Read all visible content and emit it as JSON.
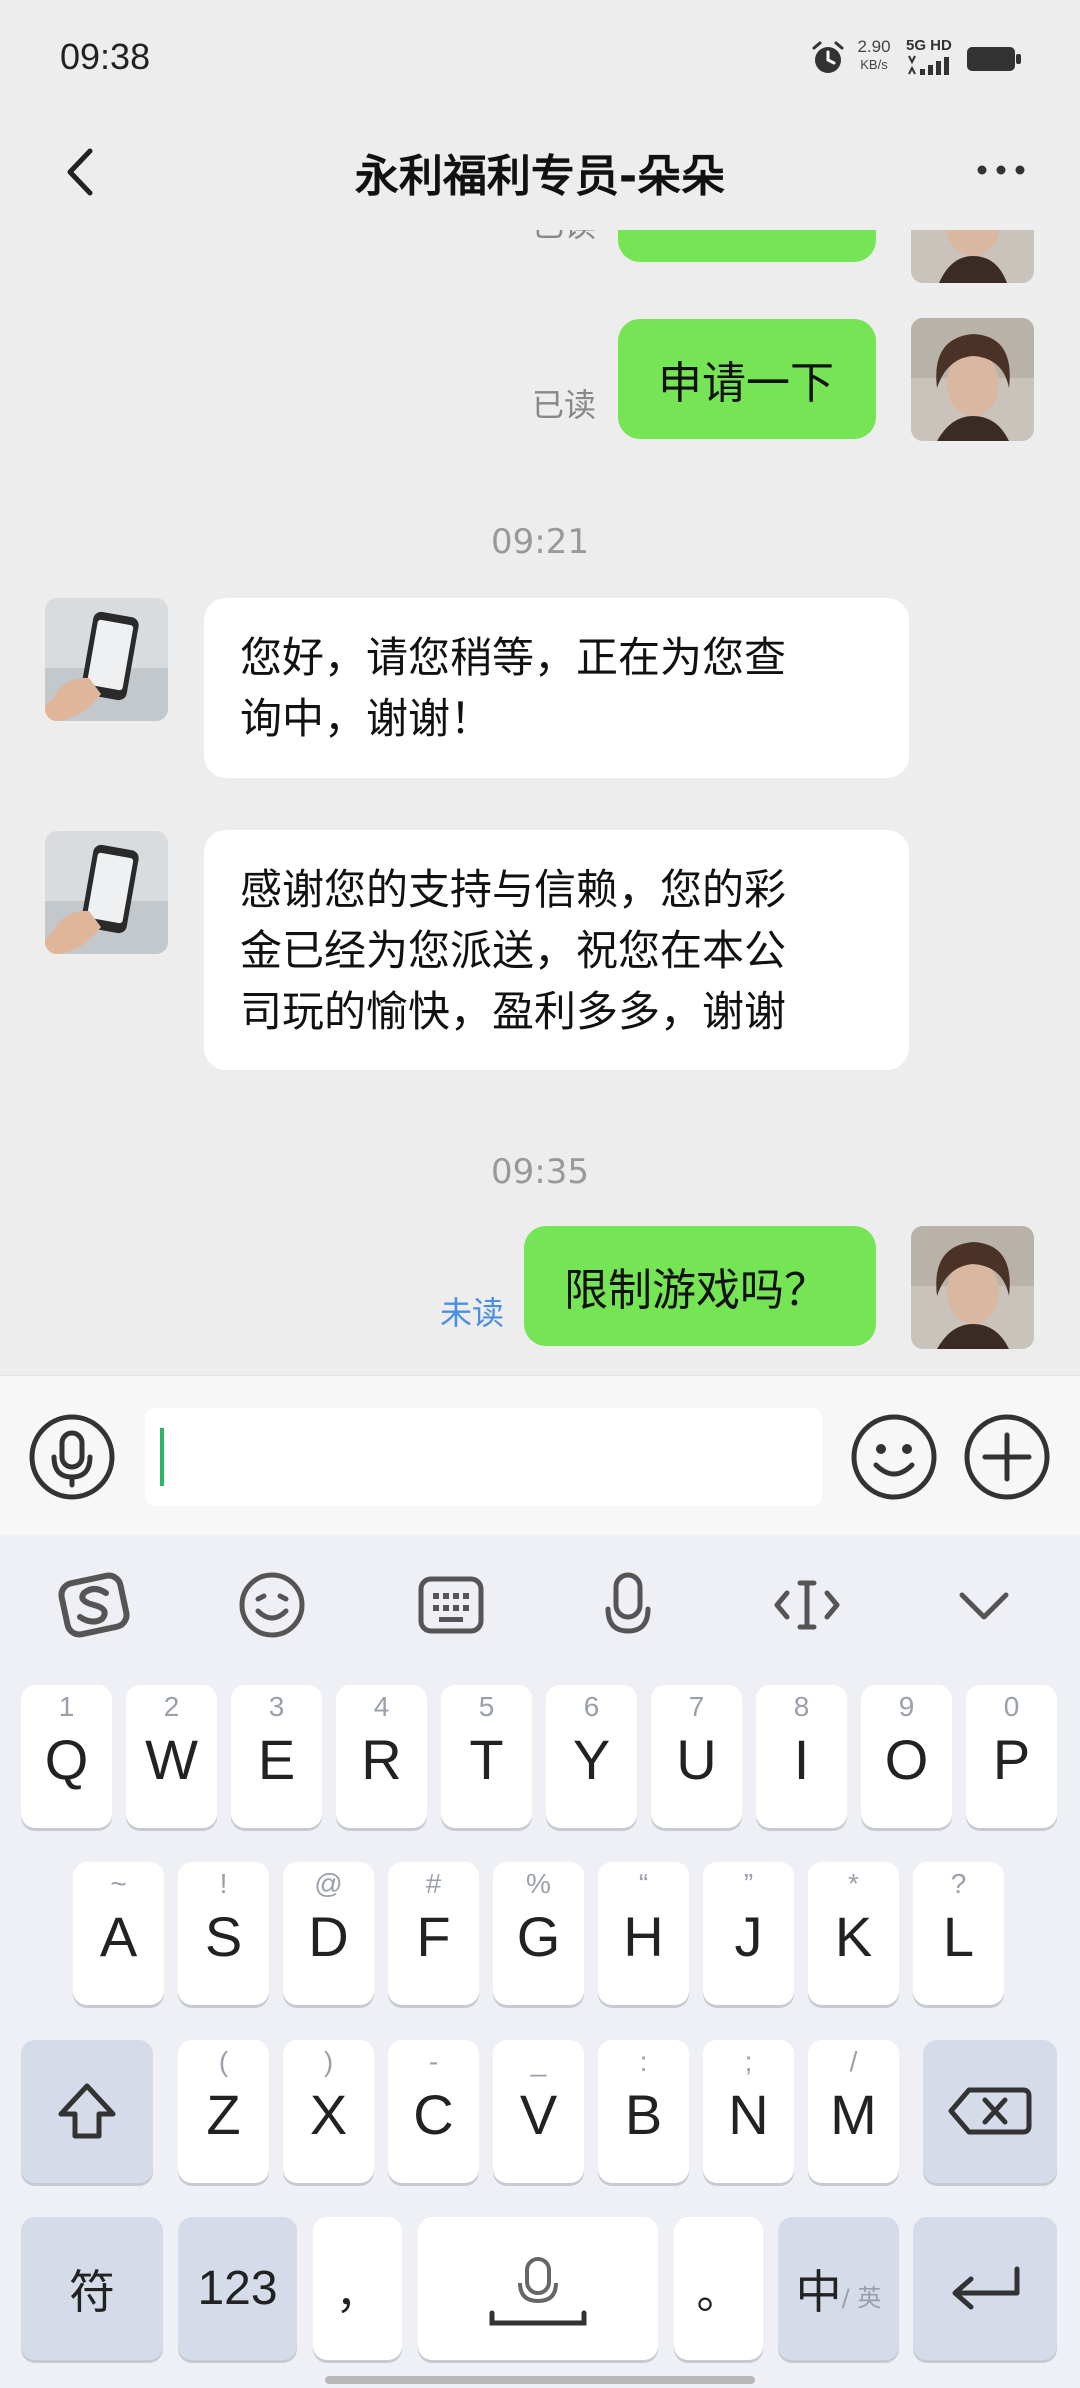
{
  "status_bar": {
    "time": "09:38",
    "net_speed_value": "2.90",
    "net_speed_unit": "KB/s",
    "signal_label": "5G HD"
  },
  "header": {
    "title": "永利福利专员-朵朵"
  },
  "chat": {
    "messages": [
      {
        "from": "me",
        "read_status": "已读"
      },
      {
        "from": "me",
        "text": "申请一下",
        "read_status": "已读"
      },
      {
        "type": "timestamp",
        "text": "09:21"
      },
      {
        "from": "other",
        "lines": [
          "您好，请您稍等，正在为您查",
          "询中，谢谢！"
        ]
      },
      {
        "from": "other",
        "lines": [
          "感谢您的支持与信赖，您的彩",
          "金已经为您派送，祝您在本公",
          "司玩的愉快，盈利多多，谢谢"
        ]
      },
      {
        "type": "timestamp",
        "text": "09:35"
      },
      {
        "from": "me",
        "text": "限制游戏吗？",
        "read_status": "未读"
      }
    ],
    "colors": {
      "my_bubble": "#75e555",
      "other_bubble": "#ffffff",
      "unread": "#4a90e2",
      "read": "#888888"
    }
  },
  "input": {
    "value": ""
  },
  "keyboard": {
    "toolbar": [
      "sogou-logo-icon",
      "emoji-icon",
      "keyboard-icon",
      "microphone-icon",
      "cursor-move-icon",
      "collapse-icon"
    ],
    "row1": [
      {
        "hint": "1",
        "key": "Q"
      },
      {
        "hint": "2",
        "key": "W"
      },
      {
        "hint": "3",
        "key": "E"
      },
      {
        "hint": "4",
        "key": "R"
      },
      {
        "hint": "5",
        "key": "T"
      },
      {
        "hint": "6",
        "key": "Y"
      },
      {
        "hint": "7",
        "key": "U"
      },
      {
        "hint": "8",
        "key": "I"
      },
      {
        "hint": "9",
        "key": "O"
      },
      {
        "hint": "0",
        "key": "P"
      }
    ],
    "row2": [
      {
        "hint": "~",
        "key": "A"
      },
      {
        "hint": "!",
        "key": "S"
      },
      {
        "hint": "@",
        "key": "D"
      },
      {
        "hint": "#",
        "key": "F"
      },
      {
        "hint": "%",
        "key": "G"
      },
      {
        "hint": "“",
        "key": "H"
      },
      {
        "hint": "”",
        "key": "J"
      },
      {
        "hint": "*",
        "key": "K"
      },
      {
        "hint": "?",
        "key": "L"
      }
    ],
    "row3": [
      {
        "hint": "(",
        "key": "Z"
      },
      {
        "hint": ")",
        "key": "X"
      },
      {
        "hint": "-",
        "key": "C"
      },
      {
        "hint": "_",
        "key": "V"
      },
      {
        "hint": ":",
        "key": "B"
      },
      {
        "hint": ";",
        "key": "N"
      },
      {
        "hint": "/",
        "key": "M"
      }
    ],
    "symbol_key": "符",
    "number_key": "123",
    "comma_key": "，",
    "period_key": "。",
    "lang_main": "中",
    "lang_alt": "/ 英"
  }
}
